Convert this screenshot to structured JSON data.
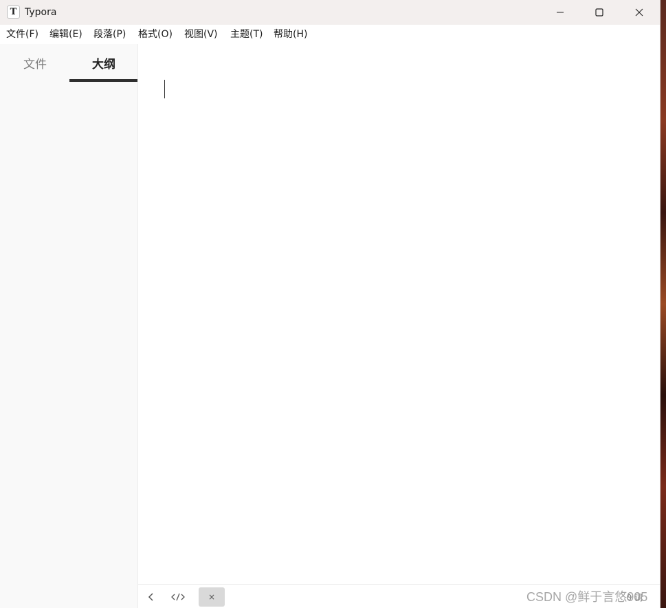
{
  "window": {
    "title": "Typora",
    "app_icon_letter": "T"
  },
  "menu": {
    "items": [
      "文件(F)",
      "编辑(E)",
      "段落(P)",
      "格式(O)",
      "视图(V)",
      "主题(T)",
      "帮助(H)"
    ]
  },
  "sidebar": {
    "tabs": [
      {
        "label": "文件",
        "active": false
      },
      {
        "label": "大纲",
        "active": true
      }
    ]
  },
  "statusbar": {
    "close_label": "×",
    "word_count": "0 词"
  },
  "watermark": "CSDN @鲜于言悠905",
  "colors": {
    "titlebar_bg": "#f3efee",
    "sidebar_bg": "#f9f9f9",
    "active_tab_underline": "#2f2f2f"
  }
}
